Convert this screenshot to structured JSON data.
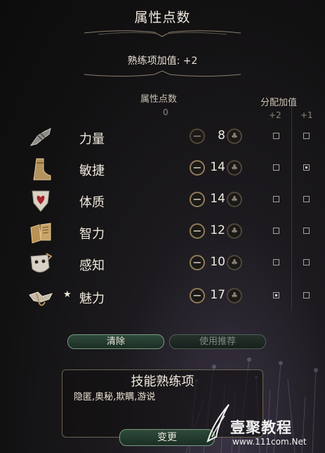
{
  "header": {
    "title": "属性点数",
    "proficiency_bonus": "熟练项加值: +2"
  },
  "columns": {
    "attribute_points": "属性点数",
    "available_points": "0",
    "bonus_header": "分配加值",
    "bonus_plus2": "+2",
    "bonus_plus1": "+1"
  },
  "abilities": [
    {
      "name": "力量",
      "icon": "gauntlet-icon",
      "value": "8",
      "star": "",
      "minus_active": false,
      "plus2": false,
      "plus1": false
    },
    {
      "name": "敏捷",
      "icon": "boot-icon",
      "value": "14",
      "star": "",
      "minus_active": true,
      "plus2": false,
      "plus1": true
    },
    {
      "name": "体质",
      "icon": "heart-shield-icon",
      "value": "14",
      "star": "",
      "minus_active": true,
      "plus2": false,
      "plus1": false
    },
    {
      "name": "智力",
      "icon": "book-icon",
      "value": "12",
      "star": "",
      "minus_active": true,
      "plus2": false,
      "plus1": false
    },
    {
      "name": "感知",
      "icon": "mask-icon",
      "value": "10",
      "star": "",
      "minus_active": true,
      "plus2": false,
      "plus1": false
    },
    {
      "name": "魅力",
      "icon": "lyre-icon",
      "value": "17",
      "star": "★",
      "minus_active": true,
      "plus2": true,
      "plus1": false
    }
  ],
  "buttons": {
    "clear": "清除",
    "use_recommended": "使用推荐",
    "change": "变更"
  },
  "skills": {
    "title": "技能熟练项",
    "list": "隐匿,奥秘,欺瞒,游说"
  },
  "watermark": {
    "text": "壹聚教程",
    "url": "www.111com.Net"
  },
  "colors": {
    "background": "#121112",
    "accent_gold": "#8f7b5a",
    "button_green": "#2e4a3b"
  }
}
